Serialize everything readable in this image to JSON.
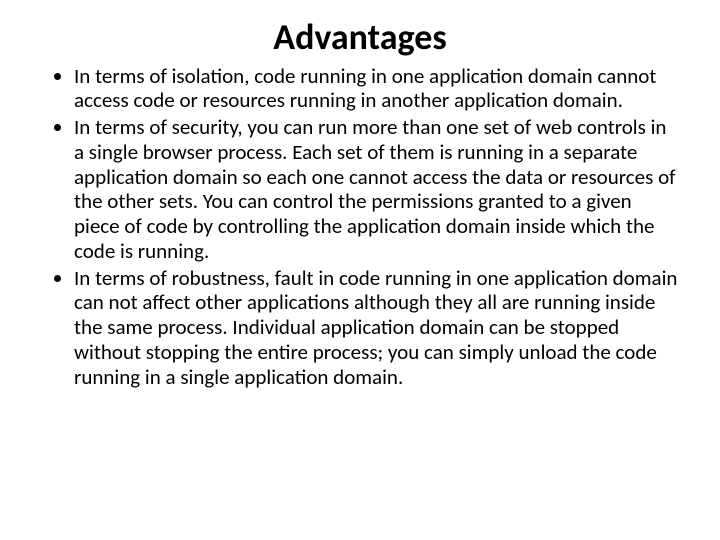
{
  "slide": {
    "title": "Advantages",
    "bullets": [
      "In terms of isolation, code running in one application domain cannot access code or resources running in another application domain.",
      "In terms of security, you can run more than one set of web controls in a single browser process. Each set of them is running in a separate application domain so each one cannot access the data or resources of the other sets. You can control the permissions granted to a given piece of code by controlling the application domain inside which the code is running.",
      "In terms of robustness, fault in code running in one application domain can not affect other applications although they all are running inside the same process. Individual application domain can be stopped without stopping the entire process; you can simply unload the code running in a single application domain."
    ]
  }
}
